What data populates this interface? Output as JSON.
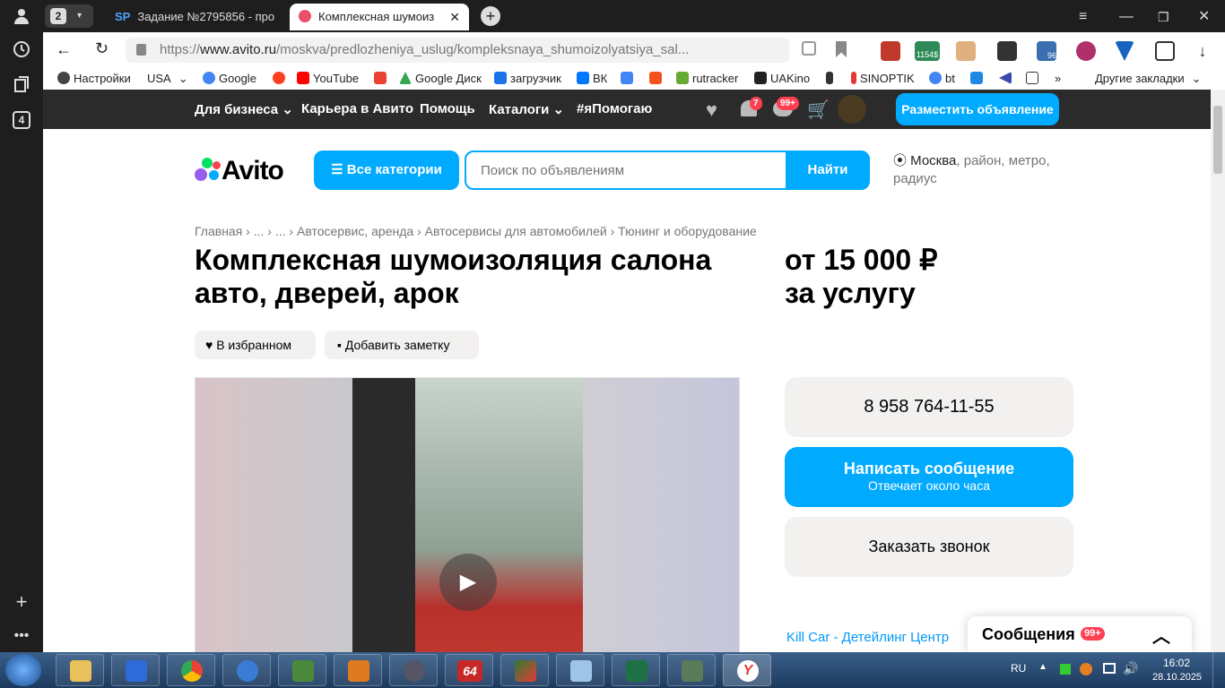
{
  "browser": {
    "tab_count": "2",
    "tabs": [
      {
        "label": "Задание №2795856 - про",
        "favicon": "SP"
      },
      {
        "label": "Комплексная шумоиз",
        "favicon": "avito-icon"
      }
    ],
    "address": {
      "url_prefix": "https://",
      "url_host": "www.avito.ru",
      "url_path": "/moskva/predlozheniya_uslug/kompleksnaya_shumoizolyatsiya_sal..."
    },
    "sidebar_badge": "4",
    "bookmarks": [
      {
        "label": "Настройки",
        "icon": "gear-icon"
      },
      {
        "label": "USA",
        "icon": "chevron-down-icon"
      },
      {
        "label": "Google",
        "icon": "google-icon"
      },
      {
        "label": "",
        "icon": "yandex-icon"
      },
      {
        "label": "YouTube",
        "icon": "youtube-icon"
      },
      {
        "label": "",
        "icon": "gmail-icon"
      },
      {
        "label": "Google Диск",
        "icon": "drive-icon"
      },
      {
        "label": "загрузчик",
        "icon": "loop-icon"
      },
      {
        "label": "ВК",
        "icon": "vk-icon"
      },
      {
        "label": "",
        "icon": "translate-icon"
      },
      {
        "label": "",
        "icon": "f-icon"
      },
      {
        "label": "rutracker",
        "icon": "rutracker-icon"
      },
      {
        "label": "UAKino",
        "icon": "film-icon"
      },
      {
        "label": "",
        "icon": "person-icon"
      },
      {
        "label": "SINOPTIK",
        "icon": "thermometer-icon"
      },
      {
        "label": "bt",
        "icon": "google-icon"
      },
      {
        "label": "",
        "icon": "p-icon"
      },
      {
        "label": "",
        "icon": "arrow-left-icon"
      },
      {
        "label": "",
        "icon": "bc-icon"
      }
    ],
    "other_bookmarks": "Другие закладки",
    "extension_badges": {
      "ext2": "1154$",
      "ext5": "96"
    }
  },
  "avito": {
    "topnav": [
      "Для бизнеса",
      "Карьера в Авито",
      "Помощь",
      "Каталоги",
      "#яПомогаю"
    ],
    "badges": {
      "notifications": "7",
      "messages": "99+"
    },
    "post_button": "Разместить объявление",
    "logo": "Avito",
    "all_categories": "Все категории",
    "search": {
      "placeholder": "Поиск по объявлениям",
      "button": "Найти"
    },
    "location": {
      "city": "Москва",
      "hint": ", район, метро, радиус"
    },
    "breadcrumb": [
      "Главная",
      "...",
      "...",
      "Автосервис, аренда",
      "Автосервисы для автомобилей",
      "Тюнинг и оборудование"
    ],
    "title": "Комплексная шумоизоляция салона авто, дверей, арок",
    "price": {
      "amount": "от 15 000 ₽",
      "unit": "за услугу"
    },
    "favorite": "В избранном",
    "note": "Добавить заметку",
    "phone": "8 958 764-11-55",
    "message": {
      "label": "Написать сообщение",
      "sub": "Отвечает около часа"
    },
    "callback": "Заказать звонок",
    "seller": "Kill Car - Детейлинг Центр",
    "messages_panel": {
      "label": "Сообщения",
      "badge": "99+"
    }
  },
  "taskbar": {
    "lang": "RU",
    "time": "16:02",
    "date": "28.10.2025",
    "app_badge": "64"
  },
  "colors": {
    "accent": "#00aaff",
    "dark": "#2b2b2b",
    "badge": "#ff4053",
    "link": "#0099f7"
  }
}
